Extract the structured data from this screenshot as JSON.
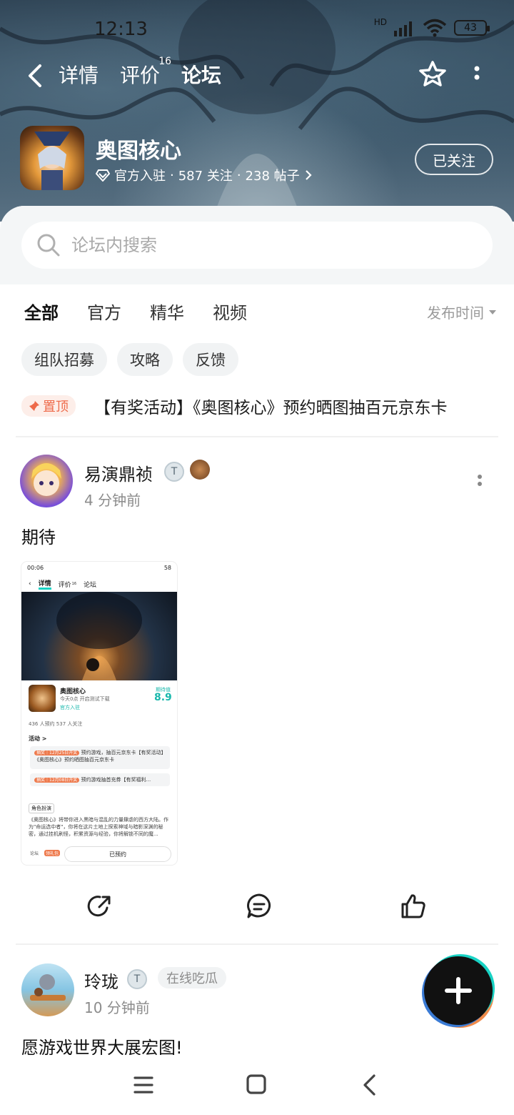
{
  "status_bar": {
    "time": "12:13",
    "network_label": "HD",
    "battery": "43"
  },
  "nav": {
    "tabs": [
      {
        "label": "详情",
        "badge": ""
      },
      {
        "label": "评价",
        "badge": "16"
      },
      {
        "label": "论坛",
        "badge": ""
      }
    ],
    "active_tab": "论坛"
  },
  "game": {
    "name": "奥图核心",
    "official": "官方入驻",
    "follow_count": "587 关注",
    "post_count": "238 帖子",
    "separator": "·",
    "follow_button": "已关注"
  },
  "search": {
    "placeholder": "论坛内搜索"
  },
  "filters": {
    "tabs": [
      "全部",
      "官方",
      "精华",
      "视频"
    ],
    "active": "全部",
    "sort_label": "发布时间"
  },
  "chips": [
    "组队招募",
    "攻略",
    "反馈"
  ],
  "pinned": {
    "badge": "置顶",
    "title": "【有奖活动】《奥图核心》预约晒图抽百元京东卡"
  },
  "posts": [
    {
      "author": "易演鼎祯",
      "time": "4 分钟前",
      "level_badge": "T",
      "text": "期待",
      "image": {
        "status_time": "00:06",
        "status_batt": "58",
        "nav_tabs": [
          "详情",
          "评价",
          "论坛"
        ],
        "nav_badge": "16",
        "game_name": "奥图核心",
        "game_sub": "今天0点 开启测试下载",
        "game_official": "官方入驻",
        "score_label": "期待值",
        "score": "8.9",
        "stats": "436 人预约    537 人关注",
        "activity_label": "活动 >",
        "activities": [
          {
            "tag": "抽奖｜12月25日开奖",
            "text": "预约游戏，抽百元京东卡【有奖活动】《奥图核心》预约晒图抽百元京东卡"
          },
          {
            "tag": "抽奖｜12月08日开奖",
            "text": "预约游戏抽首充券【有奖福利..."
          }
        ],
        "role_tag": "角色扮演",
        "desc": "《奥图核心》将带你进入黑暗与混乱的力量肆虐的西方大陆。作为\"命运选中者\"，你将在这片土地上探索神域与暗影深渊的秘密，通过挂机刷怪，积累资源与经验，你将解锁不同的魔...",
        "bottom_left": "论坛",
        "bottom_gift": "领礼包",
        "bottom_button": "已预约"
      }
    },
    {
      "author": "玲珑",
      "time": "10 分钟前",
      "level_badge": "T",
      "tag": "在线吃瓜",
      "text": "愿游戏世界大展宏图!"
    }
  ],
  "colors": {
    "accent": "#19d3c5",
    "pin": "#ee6a4a",
    "hero_bg": "#3a5366"
  },
  "icons": {
    "back": "chevron-left-icon",
    "star": "star-icon",
    "more": "more-vertical-icon",
    "search": "search-icon",
    "share": "share-icon",
    "comment": "comment-icon",
    "like": "thumbs-up-icon",
    "add": "plus-icon"
  }
}
